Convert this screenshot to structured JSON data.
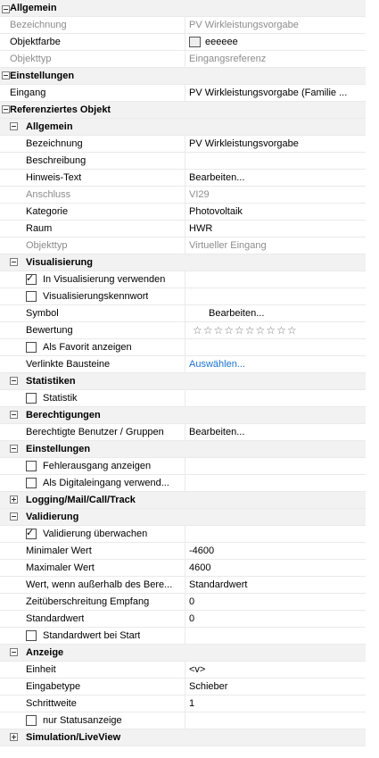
{
  "sections": {
    "allgemein": "Allgemein",
    "einstellungen": "Einstellungen",
    "referenziertes_objekt": "Referenziertes Objekt",
    "ref_allgemein": "Allgemein",
    "visualisierung": "Visualisierung",
    "statistiken": "Statistiken",
    "berechtigungen": "Berechtigungen",
    "ref_einstellungen": "Einstellungen",
    "logging": "Logging/Mail/Call/Track",
    "validierung": "Validierung",
    "anzeige": "Anzeige",
    "simulation": "Simulation/LiveView"
  },
  "allgemein": {
    "bezeichnung_label": "Bezeichnung",
    "bezeichnung_value": "PV Wirkleistungsvorgabe",
    "objektfarbe_label": "Objektfarbe",
    "objektfarbe_value": "eeeeee",
    "objektfarbe_color": "#eeeeee",
    "objekttyp_label": "Objekttyp",
    "objekttyp_value": "Eingangsreferenz"
  },
  "einstellungen": {
    "eingang_label": "Eingang",
    "eingang_value": "PV Wirkleistungsvorgabe (Familie ..."
  },
  "ref_allgemein": {
    "bezeichnung_label": "Bezeichnung",
    "bezeichnung_value": "PV Wirkleistungsvorgabe",
    "beschreibung_label": "Beschreibung",
    "beschreibung_value": "",
    "hinweis_label": "Hinweis-Text",
    "hinweis_value": "Bearbeiten...",
    "anschluss_label": "Anschluss",
    "anschluss_value": "VI29",
    "kategorie_label": "Kategorie",
    "kategorie_value": "Photovoltaik",
    "raum_label": "Raum",
    "raum_value": "HWR",
    "objekttyp_label": "Objekttyp",
    "objekttyp_value": "Virtueller Eingang"
  },
  "visualisierung": {
    "in_vis_label": "In Visualisierung verwenden",
    "in_vis_checked": true,
    "kennwort_label": "Visualisierungskennwort",
    "kennwort_checked": false,
    "symbol_label": "Symbol",
    "symbol_value": "Bearbeiten...",
    "bewertung_label": "Bewertung",
    "bewertung_stars": "☆☆☆☆☆☆☆☆☆☆",
    "bewertung_rating": 0,
    "favorit_label": "Als Favorit anzeigen",
    "favorit_checked": false,
    "bausteine_label": "Verlinkte Bausteine",
    "bausteine_value": "Auswählen..."
  },
  "statistiken": {
    "statistik_label": "Statistik",
    "statistik_checked": false
  },
  "berechtigungen": {
    "benutzer_label": "Berechtigte Benutzer / Gruppen",
    "benutzer_value": "Bearbeiten..."
  },
  "ref_einstellungen": {
    "fehler_label": "Fehlerausgang anzeigen",
    "fehler_checked": false,
    "digital_label": "Als Digitaleingang verwend...",
    "digital_checked": false
  },
  "validierung": {
    "ueberwachen_label": "Validierung überwachen",
    "ueberwachen_checked": true,
    "min_label": "Minimaler Wert",
    "min_value": "-4600",
    "max_label": "Maximaler Wert",
    "max_value": "4600",
    "ausserhalb_label": "Wert, wenn außerhalb des Bere...",
    "ausserhalb_value": "Standardwert",
    "zeit_label": "Zeitüberschreitung Empfang",
    "zeit_value": "0",
    "standard_label": "Standardwert",
    "standard_value": "0",
    "start_label": "Standardwert bei Start",
    "start_checked": false
  },
  "anzeige": {
    "einheit_label": "Einheit",
    "einheit_value": "<v>",
    "eingabetyp_label": "Eingabetype",
    "eingabetyp_value": "Schieber",
    "schrittweite_label": "Schrittweite",
    "schrittweite_value": "1",
    "status_label": "nur Statusanzeige",
    "status_checked": false
  }
}
